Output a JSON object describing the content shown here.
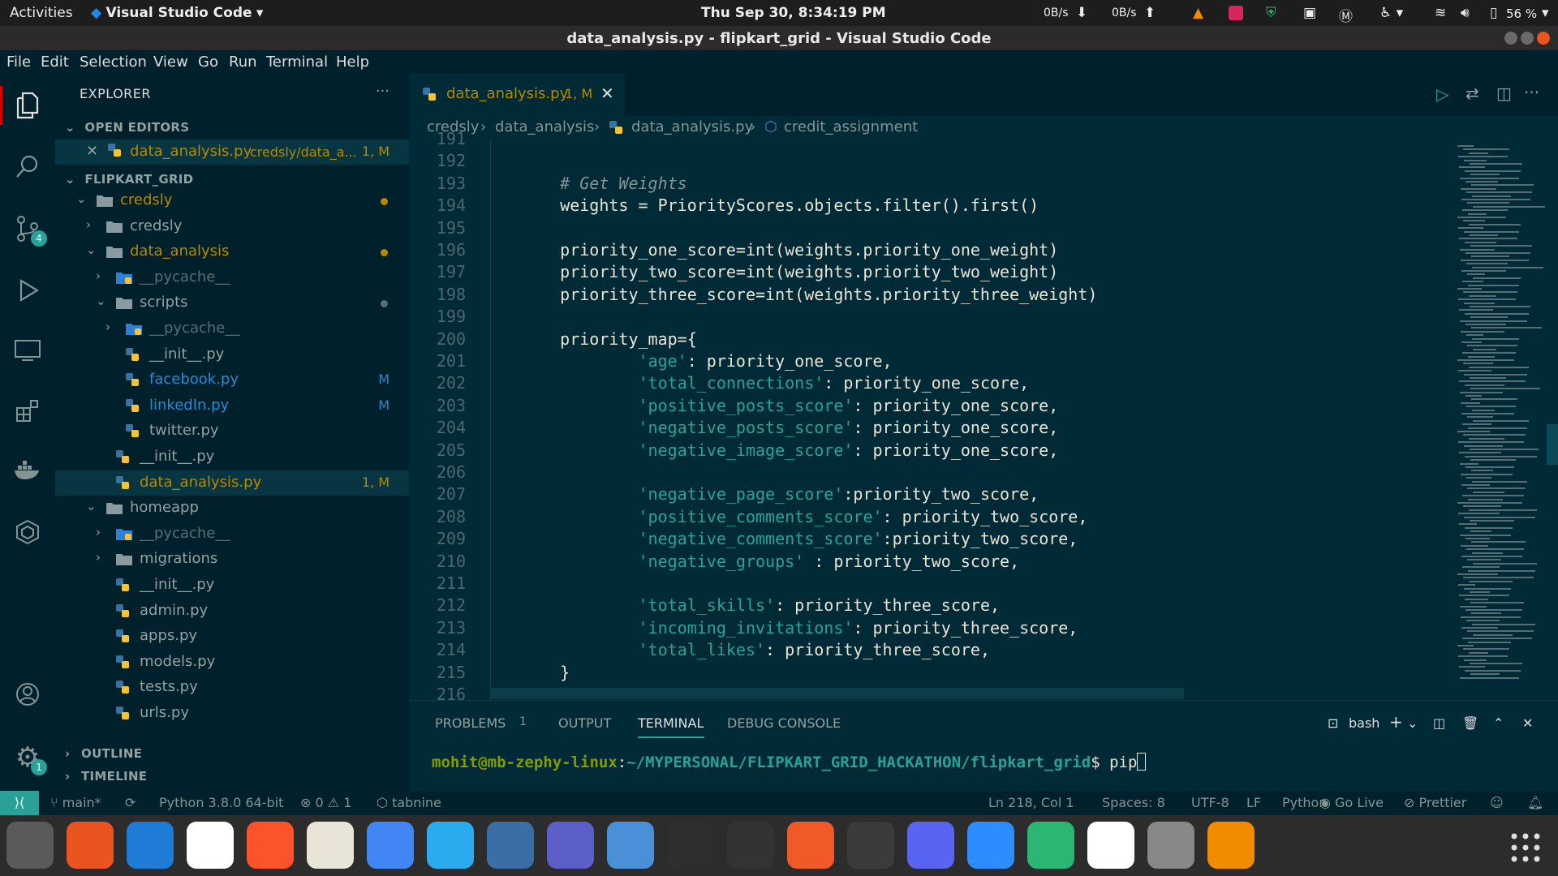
{
  "topbar": {
    "activities": "Activities",
    "app_name": "Visual Studio Code",
    "clock": "Thu Sep 30,  8:34:19 PM",
    "net_down": "0B/s",
    "net_up": "0B/s",
    "battery": "56 %"
  },
  "window": {
    "title": "data_analysis.py - flipkart_grid - Visual Studio Code"
  },
  "menu": [
    "File",
    "Edit",
    "Selection",
    "View",
    "Go",
    "Run",
    "Terminal",
    "Help"
  ],
  "activity": {
    "scm_badge": "4",
    "settings_badge": "1"
  },
  "explorer": {
    "title": "EXPLORER",
    "open_editors_label": "OPEN EDITORS",
    "open_file": "data_analysis.py",
    "open_file_path": "credsly/data_a...",
    "open_file_status": "1, M",
    "project_label": "FLIPKART_GRID",
    "tree": [
      {
        "name": "credsly",
        "depth": 0,
        "kind": "folder-open",
        "dot": true,
        "color": "#b58900"
      },
      {
        "name": "credsly",
        "depth": 1,
        "kind": "folder",
        "dot": false,
        "color": "#93a1a1"
      },
      {
        "name": "data_analysis",
        "depth": 1,
        "kind": "folder-open",
        "dot": true,
        "color": "#b58900"
      },
      {
        "name": "__pycache__",
        "depth": 2,
        "kind": "pyfolder",
        "dot": false,
        "color": "#586e75"
      },
      {
        "name": "scripts",
        "depth": 2,
        "kind": "folder-open",
        "dot": true,
        "color": "#93a1a1",
        "dot_color": "#586e75"
      },
      {
        "name": "__pycache__",
        "depth": 3,
        "kind": "pyfolder",
        "dot": false,
        "color": "#586e75"
      },
      {
        "name": "__init__.py",
        "depth": 3,
        "kind": "py",
        "dot": false,
        "color": "#93a1a1"
      },
      {
        "name": "facebook.py",
        "depth": 3,
        "kind": "py",
        "status": "M",
        "color": "#268bd2"
      },
      {
        "name": "linkedIn.py",
        "depth": 3,
        "kind": "py",
        "status": "M",
        "color": "#268bd2"
      },
      {
        "name": "twitter.py",
        "depth": 3,
        "kind": "py",
        "color": "#93a1a1"
      },
      {
        "name": "__init__.py",
        "depth": 2,
        "kind": "py",
        "color": "#93a1a1"
      },
      {
        "name": "data_analysis.py",
        "depth": 2,
        "kind": "py",
        "status": "1, M",
        "color": "#b58900",
        "selected": true
      },
      {
        "name": "homeapp",
        "depth": 1,
        "kind": "folder-open",
        "color": "#93a1a1"
      },
      {
        "name": "__pycache__",
        "depth": 2,
        "kind": "pyfolder",
        "color": "#586e75"
      },
      {
        "name": "migrations",
        "depth": 2,
        "kind": "folder",
        "color": "#93a1a1"
      },
      {
        "name": "__init__.py",
        "depth": 2,
        "kind": "py",
        "color": "#93a1a1"
      },
      {
        "name": "admin.py",
        "depth": 2,
        "kind": "py",
        "color": "#93a1a1"
      },
      {
        "name": "apps.py",
        "depth": 2,
        "kind": "py",
        "color": "#93a1a1"
      },
      {
        "name": "models.py",
        "depth": 2,
        "kind": "py",
        "color": "#93a1a1"
      },
      {
        "name": "tests.py",
        "depth": 2,
        "kind": "py",
        "color": "#93a1a1"
      },
      {
        "name": "urls.py",
        "depth": 2,
        "kind": "py",
        "color": "#93a1a1"
      }
    ],
    "outline_label": "OUTLINE",
    "timeline_label": "TIMELINE"
  },
  "tab": {
    "name": "data_analysis.py",
    "status": "1, M"
  },
  "breadcrumb": [
    "credsly",
    "data_analysis",
    "data_analysis.py",
    "credit_assignment"
  ],
  "code": [
    {
      "n": "191",
      "t": ""
    },
    {
      "n": "192",
      "t": ""
    },
    {
      "n": "193",
      "t": "    # Get Weights",
      "cls": "cm"
    },
    {
      "n": "194",
      "t": "    weights = PriorityScores.objects.filter().first()"
    },
    {
      "n": "195",
      "t": ""
    },
    {
      "n": "196",
      "t": "    priority_one_score=int(weights.priority_one_weight)"
    },
    {
      "n": "197",
      "t": "    priority_two_score=int(weights.priority_two_weight)"
    },
    {
      "n": "198",
      "t": "    priority_three_score=int(weights.priority_three_weight)"
    },
    {
      "n": "199",
      "t": ""
    },
    {
      "n": "200",
      "t": "    priority_map={"
    },
    {
      "n": "201",
      "t": "            'age': priority_one_score,"
    },
    {
      "n": "202",
      "t": "            'total_connections': priority_one_score,"
    },
    {
      "n": "203",
      "t": "            'positive_posts_score': priority_one_score,"
    },
    {
      "n": "204",
      "t": "            'negative_posts_score': priority_one_score,"
    },
    {
      "n": "205",
      "t": "            'negative_image_score': priority_one_score,"
    },
    {
      "n": "206",
      "t": ""
    },
    {
      "n": "207",
      "t": "            'negative_page_score':priority_two_score,"
    },
    {
      "n": "208",
      "t": "            'positive_comments_score': priority_two_score,"
    },
    {
      "n": "209",
      "t": "            'negative_comments_score':priority_two_score,"
    },
    {
      "n": "210",
      "t": "            'negative_groups' : priority_two_score,"
    },
    {
      "n": "211",
      "t": ""
    },
    {
      "n": "212",
      "t": "            'total_skills': priority_three_score,"
    },
    {
      "n": "213",
      "t": "            'incoming_invitations': priority_three_score,"
    },
    {
      "n": "214",
      "t": "            'total_likes': priority_three_score,"
    },
    {
      "n": "215",
      "t": "    }"
    },
    {
      "n": "216",
      "t": ""
    }
  ],
  "panel": {
    "tabs": [
      "PROBLEMS",
      "OUTPUT",
      "TERMINAL",
      "DEBUG CONSOLE"
    ],
    "problems_count": "1",
    "shell": "bash",
    "prompt_user": "mohit@mb-zephy-linux",
    "prompt_path": "~/MYPERSONAL/FLIPKART_GRID_HACKATHON/flipkart_grid",
    "command": "pip"
  },
  "status": {
    "branch": "main*",
    "python": "Python 3.8.0 64-bit",
    "errors": "0",
    "warnings": "1",
    "tabnine": "tabnine",
    "position": "Ln 218, Col 1",
    "spaces": "Spaces: 8",
    "encoding": "UTF-8",
    "eol": "LF",
    "language": "Python",
    "golive": "Go Live",
    "prettier": "Prettier"
  },
  "dock": [
    {
      "name": "files",
      "color": "#5a5a5a"
    },
    {
      "name": "software-center",
      "color": "#e95420"
    },
    {
      "name": "vscode",
      "color": "#1e7bd6"
    },
    {
      "name": "slack",
      "color": "#ffffff"
    },
    {
      "name": "brave",
      "color": "#fb542b"
    },
    {
      "name": "text-editor",
      "color": "#e8e4d8"
    },
    {
      "name": "chrome",
      "color": "#4285f4"
    },
    {
      "name": "telegram",
      "color": "#2aabee"
    },
    {
      "name": "network-tool",
      "color": "#3a6ea5"
    },
    {
      "name": "teams",
      "color": "#5b5fc7"
    },
    {
      "name": "image-viewer",
      "color": "#4a90d9"
    },
    {
      "name": "terminal",
      "color": "#2e2e2e"
    },
    {
      "name": "updater",
      "color": "#333333"
    },
    {
      "name": "inkscape-pen",
      "color": "#f05a28"
    },
    {
      "name": "sublime",
      "color": "#3b3b3b"
    },
    {
      "name": "discord",
      "color": "#5865f2"
    },
    {
      "name": "zoom",
      "color": "#2d8cff"
    },
    {
      "name": "atom",
      "color": "#2bb673"
    },
    {
      "name": "android-studio",
      "color": "#ffffff"
    },
    {
      "name": "settings",
      "color": "#888888"
    },
    {
      "name": "vlc",
      "color": "#f08c00"
    }
  ]
}
